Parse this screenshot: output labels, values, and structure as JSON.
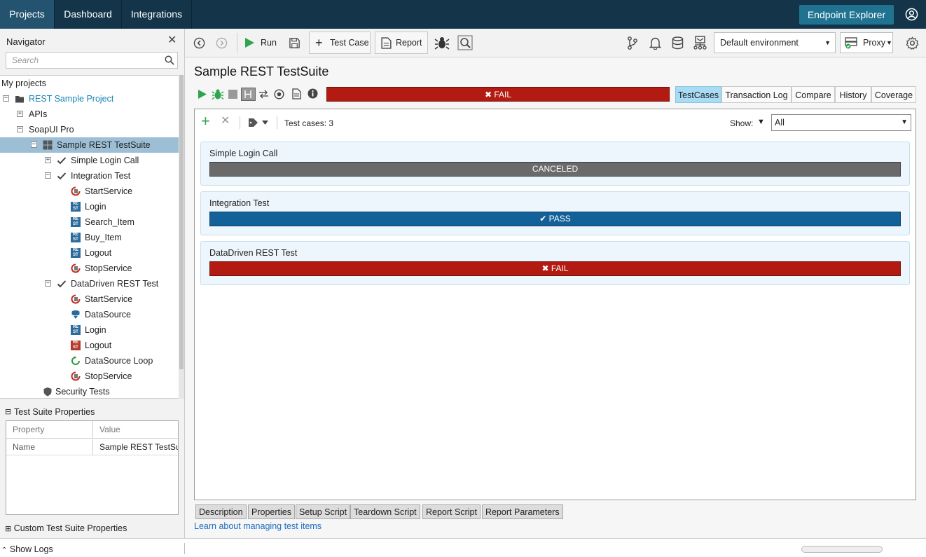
{
  "topbar": {
    "tabs": [
      {
        "label": "Projects"
      },
      {
        "label": "Dashboard"
      },
      {
        "label": "Integrations"
      }
    ],
    "endpoint_explorer": "Endpoint Explorer"
  },
  "navigator": {
    "title": "Navigator",
    "search_placeholder": "Search",
    "tree": {
      "root": "My projects",
      "project": "REST Sample Project",
      "apis": "APIs",
      "soapui": "SoapUI Pro",
      "suite": "Sample REST TestSuite",
      "tc1": "Simple Login Call",
      "tc2": "Integration Test",
      "tc2_steps": [
        "StartService",
        "Login",
        "Search_Item",
        "Buy_Item",
        "Logout",
        "StopService"
      ],
      "tc3": "DataDriven REST Test",
      "tc3_steps": [
        "StartService",
        "DataSource",
        "Login",
        "Logout",
        "DataSource Loop",
        "StopService"
      ],
      "security": "Security Tests"
    },
    "props_title": "Test Suite Properties",
    "props_headers": {
      "property": "Property",
      "value": "Value"
    },
    "props_rows": [
      {
        "property": "Name",
        "value": "Sample REST TestSu..."
      }
    ],
    "custom_props": "Custom Test Suite Properties"
  },
  "toolbar": {
    "run": "Run",
    "test_case": "Test Case",
    "report": "Report",
    "environment": "Default environment",
    "proxy": "Proxy"
  },
  "main": {
    "title": "Sample REST TestSuite",
    "suite_status": "FAIL",
    "view_tabs": [
      "TestCases",
      "Transaction Log",
      "Compare",
      "History",
      "Coverage"
    ],
    "test_cases_count": "Test cases: 3",
    "show_label": "Show:",
    "show_value": "All",
    "cases": [
      {
        "name": "Simple Login Call",
        "status": "CANCELED"
      },
      {
        "name": "Integration Test",
        "status": "PASS"
      },
      {
        "name": "DataDriven REST Test",
        "status": "FAIL"
      }
    ],
    "bottom_tabs": [
      "Description",
      "Properties",
      "Setup Script",
      "Teardown Script",
      "Report Script",
      "Report Parameters"
    ],
    "learn_link": "Learn about managing test items"
  },
  "status": {
    "show_logs": "Show Logs"
  },
  "colors": {
    "topbar": "#143549",
    "fail": "#b31b12",
    "pass": "#136199",
    "canceled": "#6a6a6a",
    "accent": "#1f7391"
  }
}
